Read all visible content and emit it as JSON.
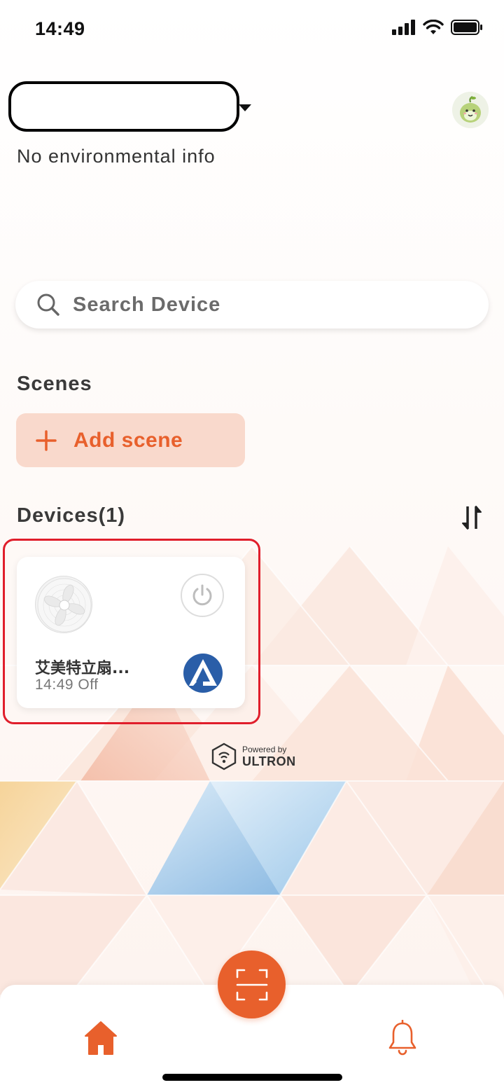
{
  "status_bar": {
    "time": "14:49"
  },
  "header": {
    "environment_info": "No environmental info"
  },
  "search": {
    "placeholder": "Search Device"
  },
  "scenes": {
    "title": "Scenes",
    "add_label": "Add scene"
  },
  "devices": {
    "title": "Devices(1)",
    "items": [
      {
        "name": "艾美特立扇...",
        "status": "14:49 Off",
        "power": "off"
      }
    ]
  },
  "footer": {
    "powered_by": "Powered by",
    "brand": "ULTRON"
  },
  "bottom_nav": {
    "items": [
      "home-icon",
      "scan-icon",
      "bell-icon"
    ]
  },
  "colors": {
    "accent": "#e8602c",
    "accent_light": "#f9d9cc",
    "highlight": "#e01e2b"
  }
}
